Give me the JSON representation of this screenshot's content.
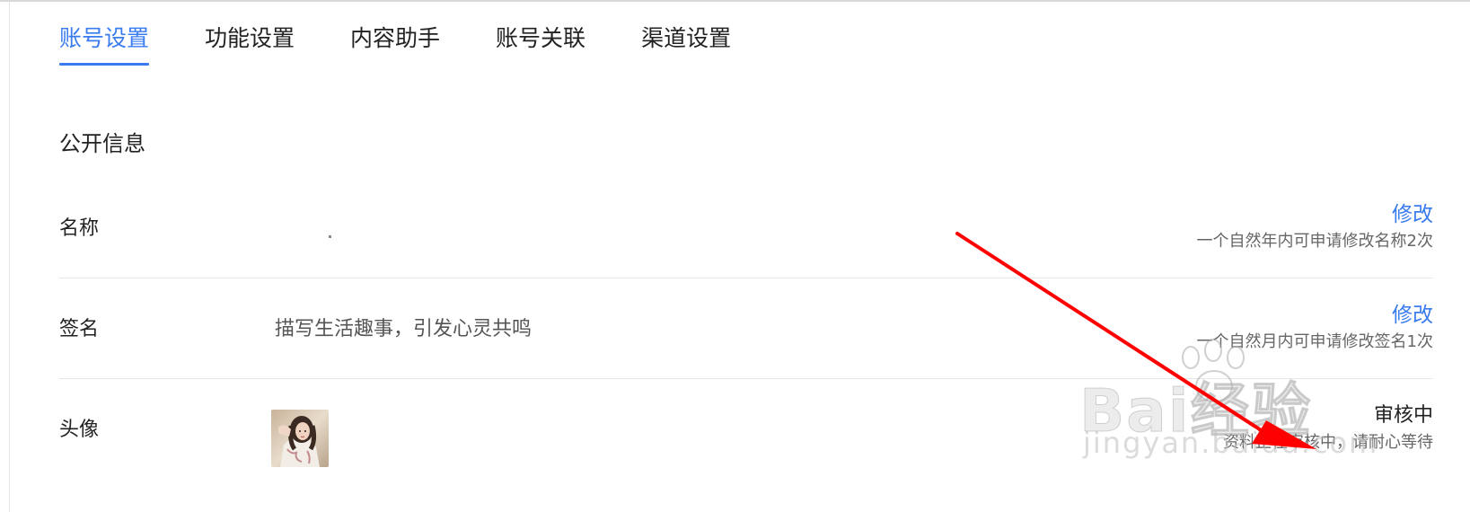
{
  "tabs": [
    {
      "label": "账号设置",
      "active": true
    },
    {
      "label": "功能设置",
      "active": false
    },
    {
      "label": "内容助手",
      "active": false
    },
    {
      "label": "账号关联",
      "active": false
    },
    {
      "label": "渠道设置",
      "active": false
    }
  ],
  "section": {
    "title": "公开信息"
  },
  "rows": {
    "name": {
      "label": "名称",
      "value": "",
      "action": "修改",
      "hint": "一个自然年内可申请修改名称2次"
    },
    "signature": {
      "label": "签名",
      "value": "描写生活趣事，引发心灵共鸣",
      "action": "修改",
      "hint": "一个自然月内可申请修改签名1次"
    },
    "avatar": {
      "label": "头像",
      "status": "审核中",
      "hint": "资料正在审核中，请耐心等待"
    }
  },
  "watermark": {
    "main": "Bai经验",
    "sub": "jingyan.baidu.com"
  },
  "colors": {
    "accent": "#3a7bf0",
    "arrow": "#ff0000",
    "divider": "#e8e8e8"
  }
}
